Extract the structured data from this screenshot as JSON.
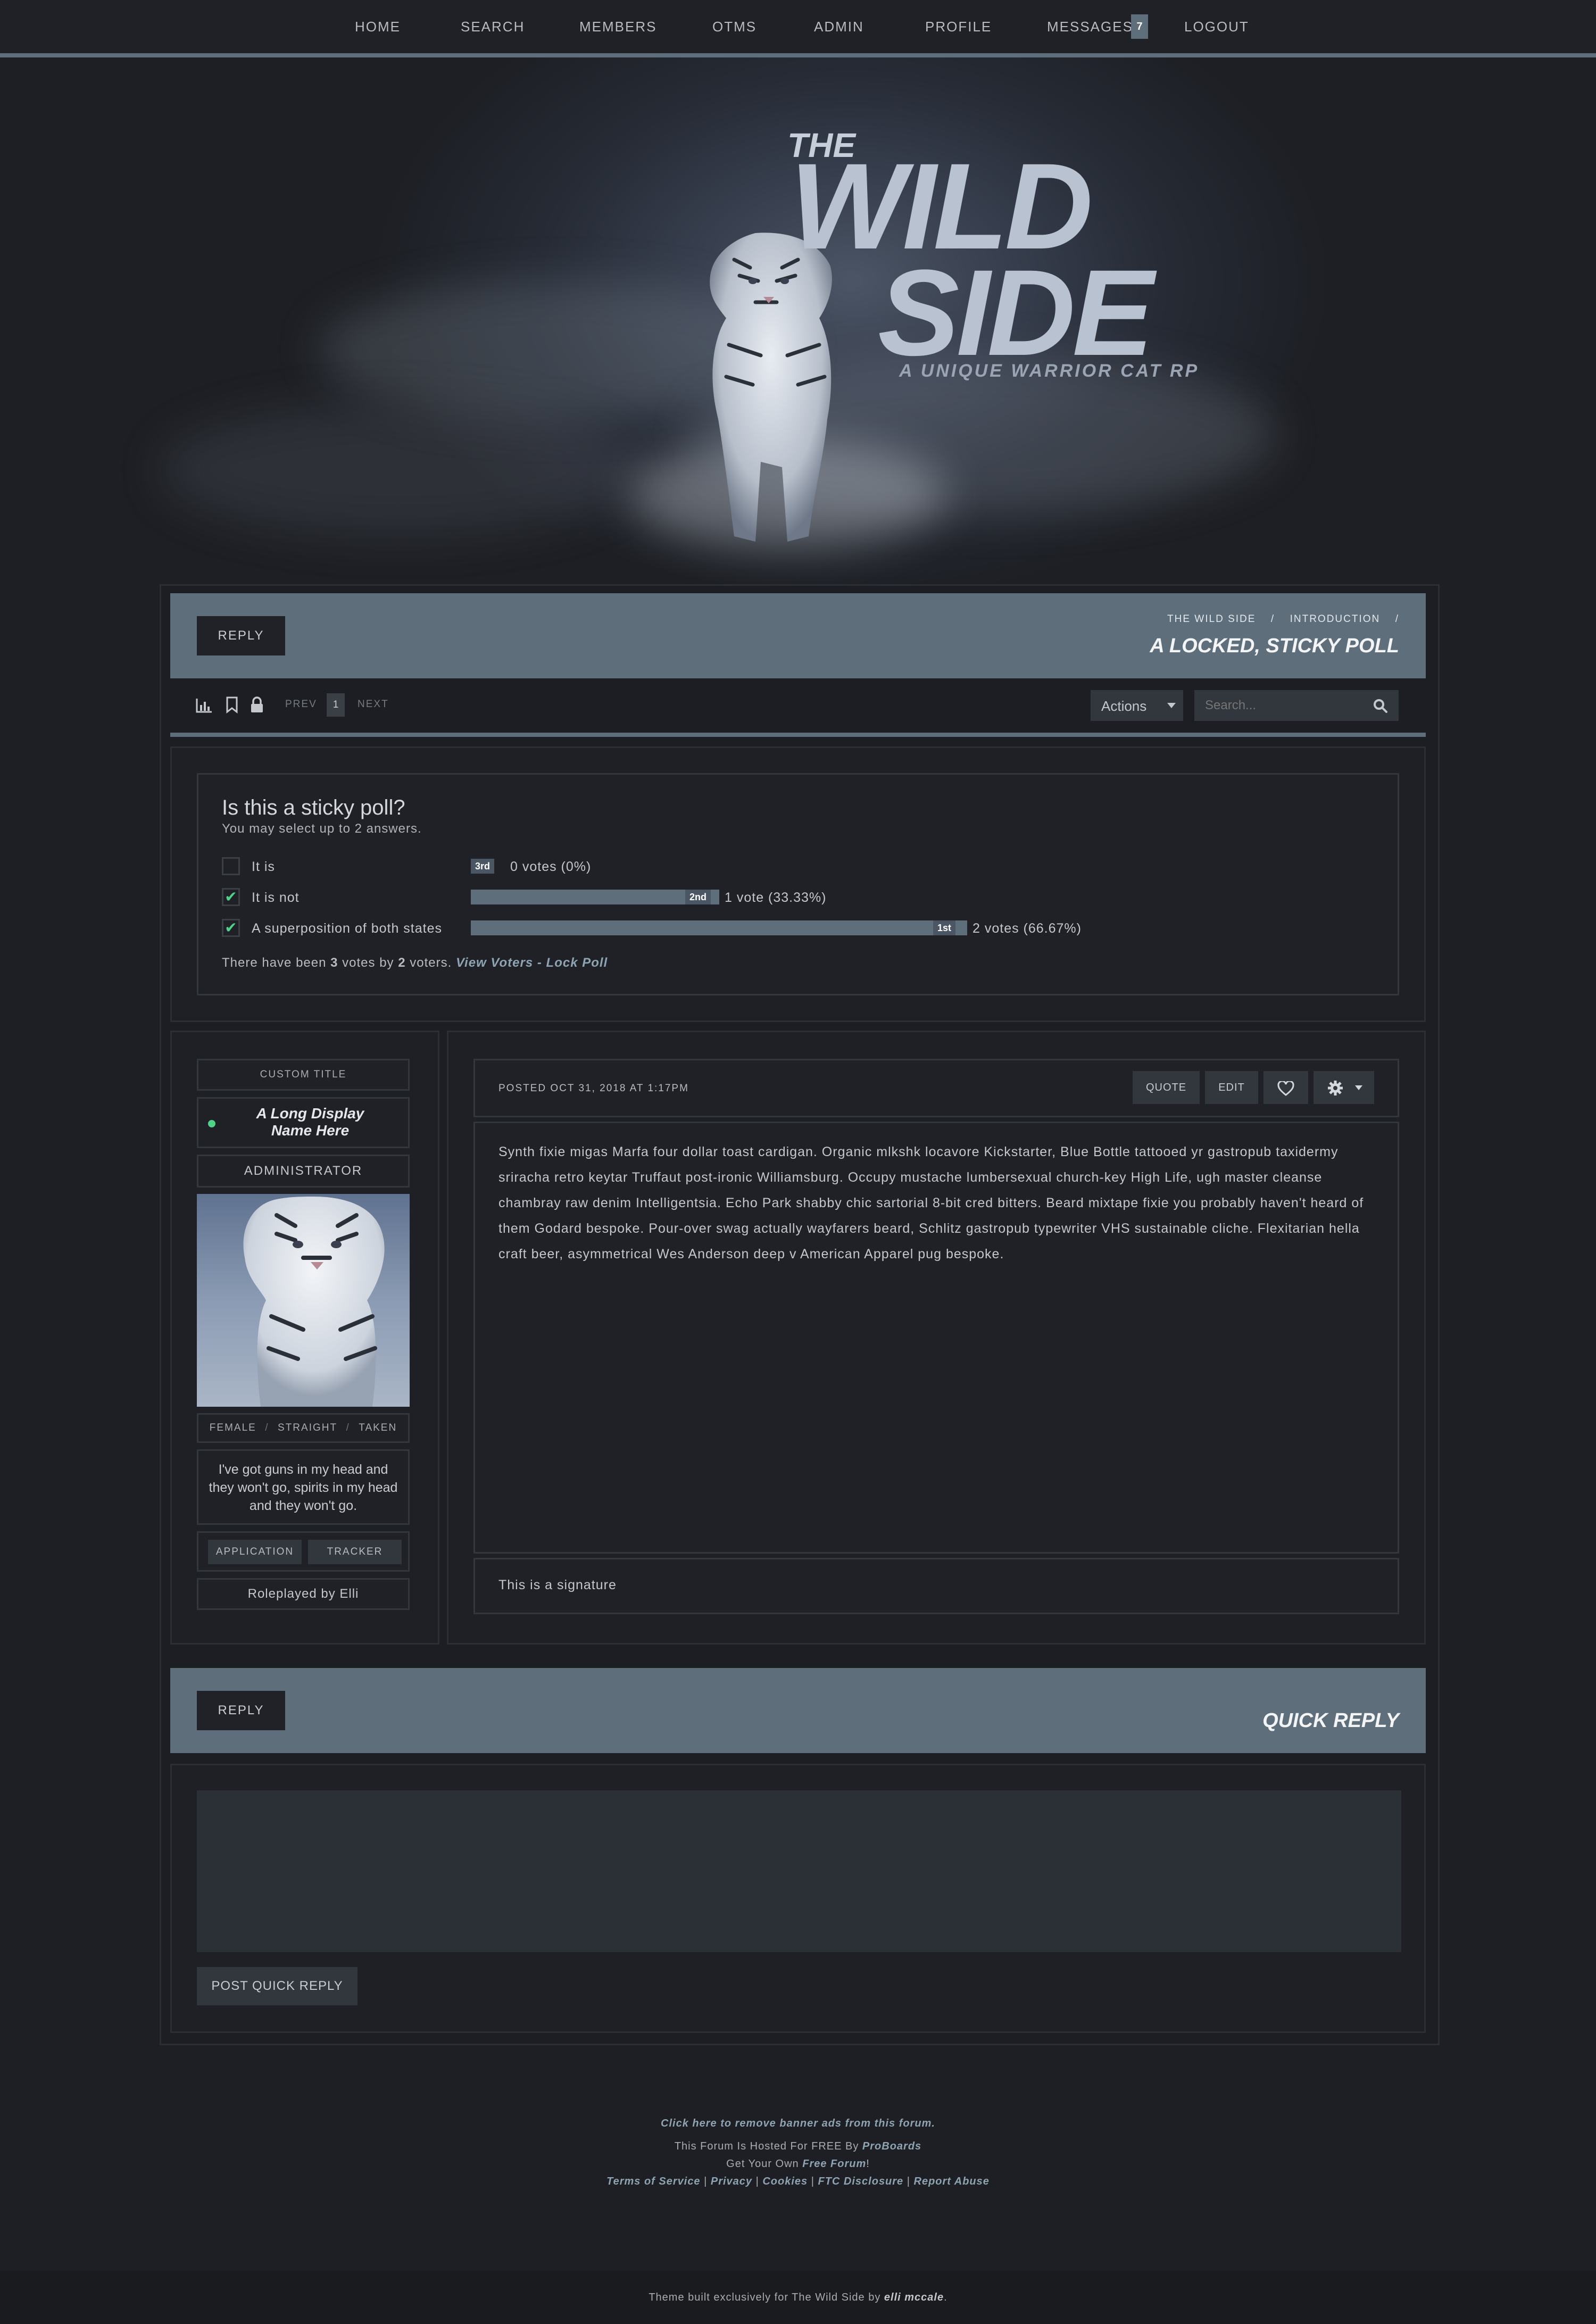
{
  "nav": {
    "home": "HOME",
    "search": "SEARCH",
    "members": "MEMBERS",
    "otms": "OTMS",
    "admin": "ADMIN",
    "profile": "PROFILE",
    "messages": "MESSAGES",
    "messages_count": "7",
    "logout": "LOGOUT"
  },
  "banner": {
    "the": "THE",
    "wild": "WILD",
    "side": "SIDE",
    "tagline": "A UNIQUE WARRIOR CAT RP"
  },
  "thread": {
    "reply_label": "REPLY",
    "breadcrumb": [
      "THE WILD SIDE",
      "/",
      "INTRODUCTION",
      "/"
    ],
    "title": "A LOCKED, STICKY POLL"
  },
  "toolbar": {
    "prev": "PREV",
    "page": "1",
    "next": "NEXT",
    "actions": "Actions",
    "search_placeholder": "Search..."
  },
  "poll": {
    "question": "Is this a sticky poll?",
    "instructions": "You may select up to 2 answers.",
    "options": [
      {
        "label": "It is",
        "checked": false,
        "rank": "3rd",
        "votes_text": "0 votes (0%)",
        "percent": 0
      },
      {
        "label": "It is not",
        "checked": true,
        "rank": "2nd",
        "votes_text": "1 vote (33.33%)",
        "percent": 33.33
      },
      {
        "label": "A superposition of both states",
        "checked": true,
        "rank": "1st",
        "votes_text": "2 votes (66.67%)",
        "percent": 66.67
      }
    ],
    "summary_prefix": "There have been ",
    "total_votes": "3",
    "summary_mid": " votes by ",
    "total_voters": "2",
    "summary_suffix": " voters. ",
    "view_voters": "View Voters",
    "separator": " - ",
    "lock_poll": "Lock Poll"
  },
  "user": {
    "custom_title": "CUSTOM TITLE",
    "display_name_line1": "A Long Display",
    "display_name_line2": "Name Here",
    "rank": "ADMINISTRATOR",
    "tags": [
      "FEMALE",
      "/",
      "STRAIGHT",
      "/",
      "TAKEN"
    ],
    "quote": "I've got guns in my head and they won't go, spirits in my head and they won't go.",
    "application": "APPLICATION",
    "tracker": "TRACKER",
    "roleplayed_by": "Roleplayed by Elli"
  },
  "post": {
    "date": "POSTED OCT 31, 2018 AT 1:17PM",
    "quote": "QUOTE",
    "edit": "EDIT",
    "body": "Synth fixie migas Marfa four dollar toast cardigan. Organic mlkshk locavore Kickstarter, Blue Bottle tattooed yr gastropub taxidermy sriracha retro keytar Truffaut post-ironic Williamsburg. Occupy mustache lumbersexual church-key High Life, ugh master cleanse chambray raw denim Intelligentsia. Echo Park shabby chic sartorial 8-bit cred bitters. Beard mixtape fixie you probably haven't heard of them Godard bespoke. Pour-over swag actually wayfarers beard, Schlitz gastropub typewriter VHS sustainable cliche. Flexitarian hella craft beer, asymmetrical Wes Anderson deep v American Apparel pug bespoke.",
    "signature": "This is a signature"
  },
  "quick_reply": {
    "reply_label": "REPLY",
    "title": "QUICK REPLY",
    "post_button": "POST QUICK REPLY"
  },
  "footer": {
    "remove_ads": "Click here to remove banner ads from this forum.",
    "hosted_prefix": "This Forum Is Hosted For FREE By ",
    "proboards": "ProBoards",
    "get_own_prefix": "Get Your Own ",
    "free_forum": "Free Forum",
    "get_own_suffix": "!",
    "terms": "Terms of Service",
    "privacy": "Privacy",
    "cookies": "Cookies",
    "ftc": "FTC Disclosure",
    "report": "Report Abuse",
    "pipe": " | ",
    "theme_prefix": "Theme built exclusively for The Wild Side by ",
    "theme_author": "elli mccale",
    "theme_suffix": "."
  },
  "colors": {
    "accent": "#5e6f7b",
    "background": "#1d1f24",
    "online_dot": "#4fd38a",
    "check": "#4fd38a"
  },
  "icons": [
    "stats-icon",
    "bookmark-icon",
    "lock-icon",
    "search-icon",
    "heart-icon",
    "gear-icon",
    "caret-down-icon"
  ]
}
